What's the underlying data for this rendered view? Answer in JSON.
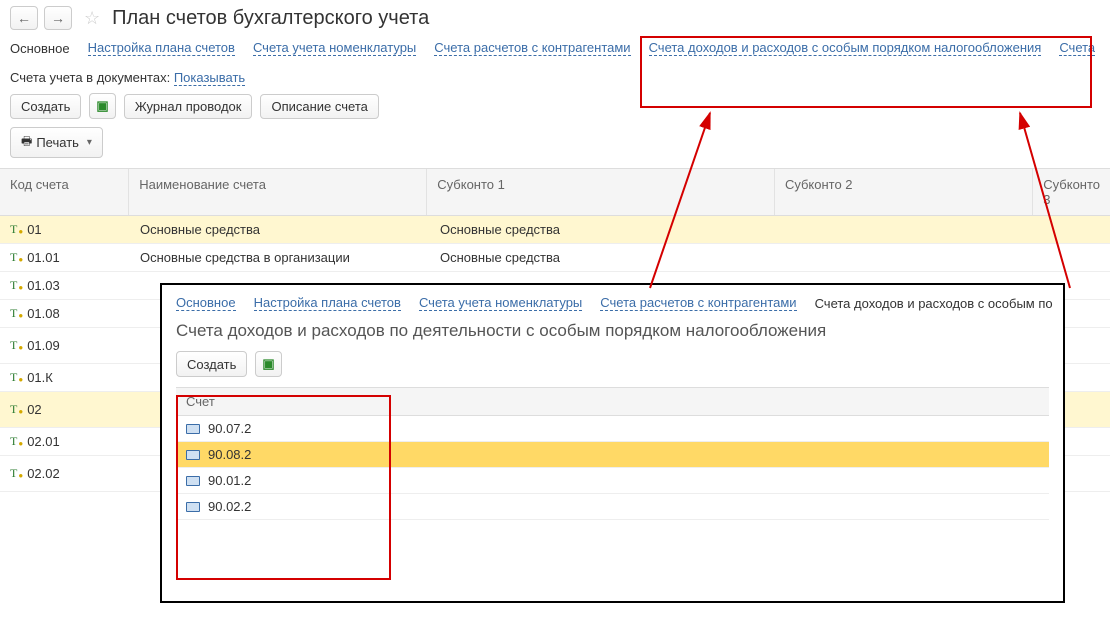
{
  "header": {
    "title": "План счетов бухгалтерского учета"
  },
  "tabs": {
    "main": "Основное",
    "setup": "Настройка плана счетов",
    "nomen": "Счета учета номенклатуры",
    "contr": "Счета расчетов с контрагентами",
    "tax": "Счета доходов и расходов с особым порядком налогообложения",
    "more": "Счета"
  },
  "info": {
    "label": "Счета учета в документах:",
    "link": "Показывать"
  },
  "toolbar": {
    "create": "Создать",
    "journal": "Журнал проводок",
    "desc": "Описание счета",
    "print": "Печать"
  },
  "columns": {
    "code": "Код счета",
    "name": "Наименование счета",
    "sub1": "Субконто 1",
    "sub2": "Субконто 2",
    "sub3": "Субконто 3"
  },
  "rows": [
    {
      "code": "01",
      "name": "Основные средства",
      "sub1": "Основные средства"
    },
    {
      "code": "01.01",
      "name": "Основные средства в организации",
      "sub1": "Основные средства"
    },
    {
      "code": "01.03",
      "name": "",
      "sub1": ""
    },
    {
      "code": "01.08",
      "name": "",
      "sub1": ""
    },
    {
      "code": "01.09",
      "name": "",
      "sub1": ""
    },
    {
      "code": "01.К",
      "name": "",
      "sub1": ""
    },
    {
      "code": "02",
      "name": "",
      "sub1": ""
    },
    {
      "code": "02.01",
      "name": "",
      "sub1": ""
    },
    {
      "code": "02.02",
      "name": "",
      "sub1": ""
    }
  ],
  "inner": {
    "tabs": {
      "main": "Основное",
      "setup": "Настройка плана счетов",
      "nomen": "Счета учета номенклатуры",
      "contr": "Счета расчетов с контрагентами",
      "tax": "Счета доходов и расходов с особым по"
    },
    "title": "Счета доходов и расходов по деятельности с особым порядком налогообложения",
    "toolbar": {
      "create": "Создать"
    },
    "column": "Счет",
    "rows": [
      "90.07.2",
      "90.08.2",
      "90.01.2",
      "90.02.2"
    ]
  }
}
